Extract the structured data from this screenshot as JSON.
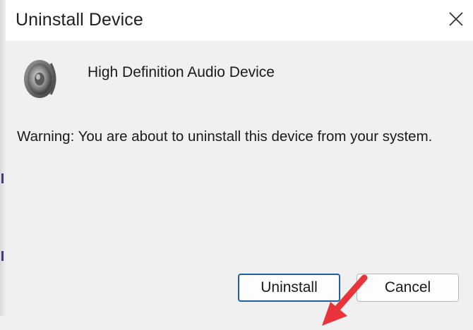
{
  "dialog": {
    "title": "Uninstall Device",
    "device_name": "High Definition Audio Device",
    "warning": "Warning: You are about to uninstall this device from your system.",
    "icons": {
      "close": "close-icon",
      "device": "speaker-icon",
      "annotation": "red-arrow-icon"
    }
  },
  "buttons": {
    "uninstall_label": "Uninstall",
    "cancel_label": "Cancel"
  },
  "colors": {
    "accent_border": "#1f5fa8",
    "annotation_arrow": "#e8343a"
  }
}
